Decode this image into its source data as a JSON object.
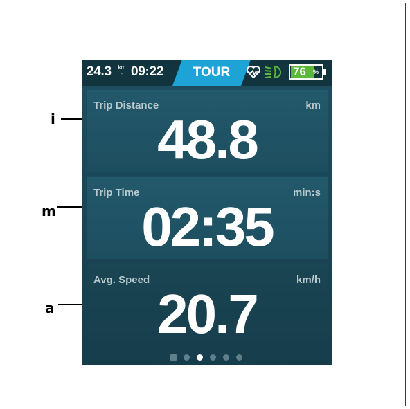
{
  "status_bar": {
    "speed": "24.3",
    "speed_unit_top": "km",
    "speed_unit_bottom": "h",
    "time": "09:22",
    "mode": "TOUR",
    "battery_percent": 76,
    "battery_text": "76",
    "battery_symbol": "%",
    "icons": [
      "heart-rate-icon",
      "headlight-icon",
      "battery-icon"
    ],
    "colors": {
      "mode_bg": "#1ea3d6",
      "battery_fill": "#5cb83b"
    }
  },
  "panels": [
    {
      "label": "Trip Distance",
      "unit": "km",
      "value": "48.8"
    },
    {
      "label": "Trip Time",
      "unit": "min:s",
      "value": "02:35"
    },
    {
      "label": "Avg. Speed",
      "unit": "km/h",
      "value": "20.7"
    }
  ],
  "page_indicator": {
    "count": 6,
    "active_index": 2
  },
  "callouts": {
    "i": "i",
    "m": "m",
    "a": "a"
  }
}
